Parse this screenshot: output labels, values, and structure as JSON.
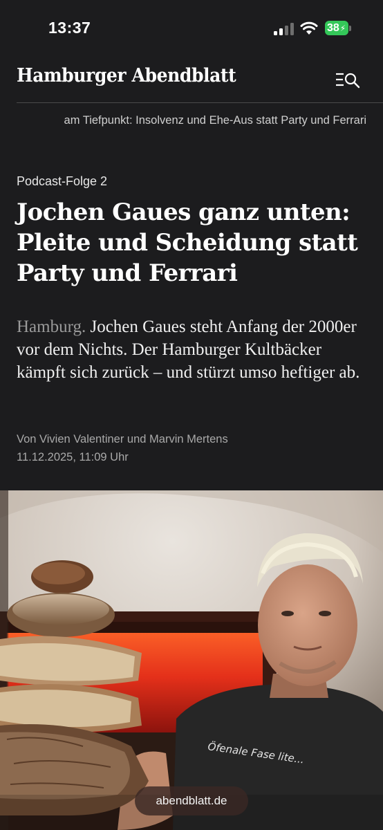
{
  "status_bar": {
    "time": "13:37",
    "battery": "38"
  },
  "header": {
    "logo": "Hamburger Abendblatt"
  },
  "ticker": {
    "text": "am Tiefpunkt: Insolvenz und Ehe-Aus statt Party und Ferrari"
  },
  "article": {
    "kicker": "Podcast-Folge 2",
    "headline": "Jochen Gaues ganz unten: Pleite und Scheidung statt Party und Ferrari",
    "dateline": "Hamburg.",
    "teaser": "Jochen Gaues steht Anfang der 2000er vor dem Nichts. Der Hamburger Kultbäcker kämpft sich zurück – und stürzt umso heftiger ab.",
    "authors": "Von Vivien Valentiner und Marvin Mertens",
    "date": "11.12.2025, 11:09 Uhr"
  },
  "hero_image": {
    "shirt_text": "Öfenale Fase lite..."
  },
  "browser": {
    "url": "abendblatt.de"
  },
  "colors": {
    "background": "#1c1c1e",
    "battery": "#34c759"
  },
  "icons": [
    "wifi-icon",
    "signal-icon",
    "battery-icon",
    "menu-search-icon"
  ]
}
